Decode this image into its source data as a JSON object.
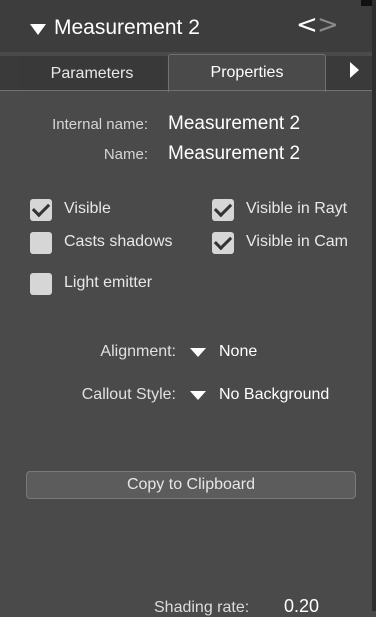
{
  "header": {
    "title": "Measurement 2",
    "prev_glyph": "<",
    "next_glyph": ">"
  },
  "tabs": [
    {
      "label": "Parameters",
      "active": false
    },
    {
      "label": "Properties",
      "active": true
    }
  ],
  "properties": {
    "internal_name_label": "Internal name:",
    "internal_name_value": "Measurement 2",
    "name_label": "Name:",
    "name_value": "Measurement 2"
  },
  "checkboxes": [
    {
      "label": "Visible",
      "checked": true
    },
    {
      "label": "Visible in Rayt",
      "checked": true
    },
    {
      "label": "Casts shadows",
      "checked": false
    },
    {
      "label": "Visible in Cam",
      "checked": true
    },
    {
      "label": "Light emitter",
      "checked": false
    }
  ],
  "dropdowns": {
    "alignment_label": "Alignment:",
    "alignment_value": "None",
    "callout_label": "Callout Style:",
    "callout_value": "No Background"
  },
  "buttons": {
    "copy_label": "Copy to Clipboard"
  },
  "shading": {
    "label": "Shading rate:",
    "value": "0.20"
  },
  "colors": {
    "panel_bg": "#4a4a4a",
    "header_bg": "#3d3d3d",
    "checkbox_fill": "#d6d6d6"
  }
}
